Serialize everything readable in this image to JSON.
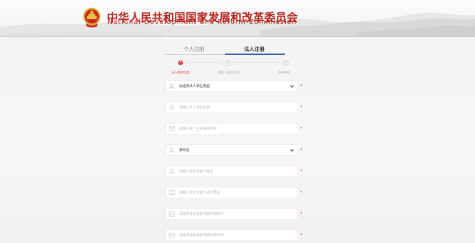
{
  "header": {
    "title_cn": "中华人民共和国国家发展和改革委员会",
    "title_en": "National Development and Reform Commission"
  },
  "tabs": [
    {
      "label": "个人注册",
      "active": false
    },
    {
      "label": "法人注册",
      "active": true
    }
  ],
  "steps": [
    {
      "number": "1",
      "label": "法人基本信息",
      "active": true
    },
    {
      "number": "2",
      "label": "经办人基本信息",
      "active": false
    },
    {
      "number": "3",
      "label": "注册完成",
      "active": false
    }
  ],
  "form": {
    "required_mark": "*",
    "fields": [
      {
        "name": "org-type-select",
        "icon": "user-icon",
        "type": "select",
        "value": "请选择法人单位类型"
      },
      {
        "name": "org-name-input",
        "icon": "user-icon",
        "type": "input",
        "placeholder": "请输入法人单位名称"
      },
      {
        "name": "credit-code-input",
        "icon": "envelope-icon",
        "type": "input",
        "placeholder": "请输入统一社会信用代码"
      },
      {
        "name": "id-type-select",
        "icon": "user-icon",
        "type": "select",
        "value": "身份证"
      },
      {
        "name": "rep-name-input",
        "icon": "user-icon",
        "type": "input",
        "placeholder": "请输入法定代表人姓名"
      },
      {
        "name": "rep-id-number-input",
        "icon": "card-icon",
        "type": "input",
        "placeholder": "请输入法定代表人证件号码"
      },
      {
        "name": "id-valid-start-input",
        "icon": "calendar-icon",
        "type": "input",
        "placeholder": "请选择身份证有效期开始时间"
      },
      {
        "name": "id-valid-end-input",
        "icon": "calendar-icon",
        "type": "input",
        "placeholder": "请选择身份证有效期结束时间"
      }
    ]
  },
  "colors": {
    "brand_red": "#b32018",
    "active_step_red": "#e03a3a",
    "tab_accent_blue": "#3c5fb0"
  }
}
